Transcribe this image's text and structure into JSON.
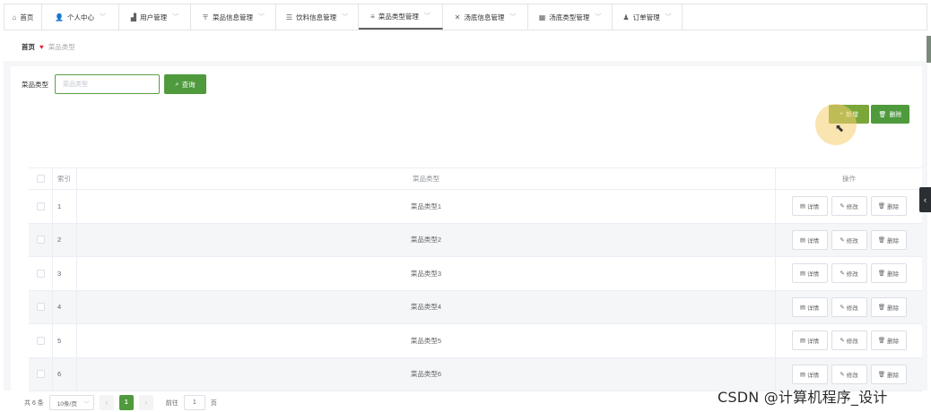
{
  "nav": [
    {
      "icon": "⌂",
      "label": "首页",
      "chevron": false
    },
    {
      "icon": "👤",
      "label": "个人中心",
      "chevron": true
    },
    {
      "icon": "▟",
      "label": "用户管理",
      "chevron": true
    },
    {
      "icon": "〒",
      "label": "菜品信息管理",
      "chevron": true
    },
    {
      "icon": "☰",
      "label": "饮料信息管理",
      "chevron": true
    },
    {
      "icon": "≡",
      "label": "菜品类型管理",
      "chevron": true
    },
    {
      "icon": "✕",
      "label": "汤底信息管理",
      "chevron": true
    },
    {
      "icon": "▦",
      "label": "汤底类型管理",
      "chevron": true
    },
    {
      "icon": "♟",
      "label": "订单管理",
      "chevron": true
    }
  ],
  "breadcrumb": {
    "home": "首页",
    "current": "菜品类型"
  },
  "search": {
    "label": "菜品类型",
    "placeholder": "菜品类型",
    "button": "查询"
  },
  "actions": {
    "add": "新增",
    "delete": "删除"
  },
  "table": {
    "headers": {
      "index": "索引",
      "type": "菜品类型",
      "ops": "操作"
    },
    "rows": [
      {
        "index": "1",
        "type": "菜品类型1"
      },
      {
        "index": "2",
        "type": "菜品类型2"
      },
      {
        "index": "3",
        "type": "菜品类型3"
      },
      {
        "index": "4",
        "type": "菜品类型4"
      },
      {
        "index": "5",
        "type": "菜品类型5"
      },
      {
        "index": "6",
        "type": "菜品类型6"
      }
    ],
    "row_ops": {
      "detail": "详情",
      "edit": "修改",
      "delete": "删除"
    }
  },
  "pagination": {
    "total": "共 6 条",
    "page_size": "10条/页",
    "current_page": "1",
    "goto_label": "前往",
    "goto_value": "1",
    "page_suffix": "页"
  },
  "watermark": "CSDN @计算机程序_设计",
  "colors": {
    "primary": "#4e9a3d",
    "heart": "#e0283b"
  }
}
